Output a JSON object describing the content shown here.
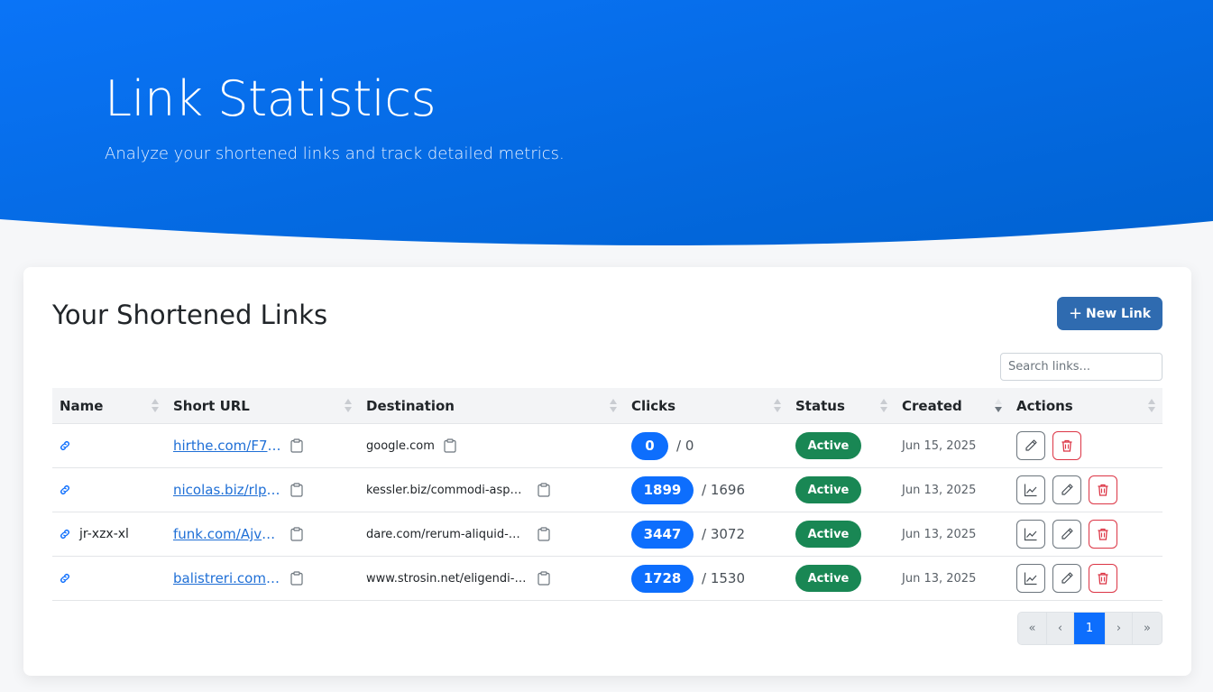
{
  "hero": {
    "title": "Link Statistics",
    "subtitle": "Analyze your shortened links and track detailed metrics.",
    "gradient_start": "#0a74f7",
    "gradient_end": "#0062d1"
  },
  "links_section": {
    "title": "Your Shortened Links",
    "new_link_label": "New Link",
    "search_placeholder": "Search links..."
  },
  "table": {
    "columns": [
      "Name",
      "Short URL",
      "Destination",
      "Clicks",
      "Status",
      "Created",
      "Actions"
    ],
    "sorted_column": "Created",
    "rows": [
      {
        "name": "",
        "short_url": "hirthe.com/F7R...",
        "destination": "google.com",
        "clicks": "0",
        "total": "/ 0",
        "status": "Active",
        "created": "Jun 15, 2025",
        "has_stats": false
      },
      {
        "name": "",
        "short_url": "nicolas.biz/rlpe...",
        "destination": "kessler.biz/commodi-aspe...",
        "clicks": "1899",
        "total": "/ 1696",
        "status": "Active",
        "created": "Jun 13, 2025",
        "has_stats": true
      },
      {
        "name": "jr-xzx-xl",
        "short_url": "funk.com/Ajvsv...",
        "destination": "dare.com/rerum-aliquid-al...",
        "clicks": "3447",
        "total": "/ 3072",
        "status": "Active",
        "created": "Jun 13, 2025",
        "has_stats": true
      },
      {
        "name": "",
        "short_url": "balistreri.com/...",
        "destination": "www.strosin.net/eligendi-f...",
        "clicks": "1728",
        "total": "/ 1530",
        "status": "Active",
        "created": "Jun 13, 2025",
        "has_stats": true
      }
    ]
  },
  "pagination": {
    "first": "«",
    "prev": "‹",
    "current": "1",
    "next": "›",
    "last": "»"
  },
  "colors": {
    "primary": "#0d6efd",
    "success": "#198754",
    "danger": "#dc3545",
    "button": "#2f6bb0"
  }
}
